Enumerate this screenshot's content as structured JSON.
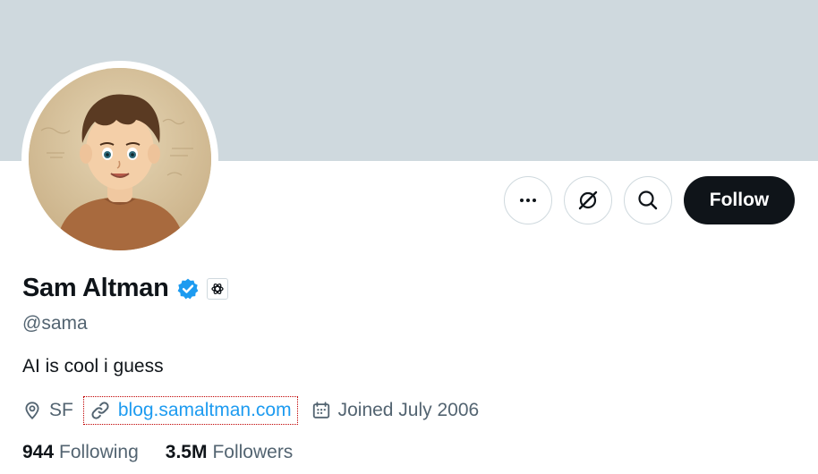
{
  "profile": {
    "name": "Sam Altman",
    "handle": "@sama",
    "bio": "AI is cool i guess",
    "location": "SF",
    "website": "blog.samaltman.com",
    "joined": "Joined July 2006"
  },
  "actions": {
    "follow_label": "Follow",
    "more_icon": "more-horizontal-icon",
    "grok_icon": "grok-icon",
    "search_icon": "search-icon"
  },
  "stats": {
    "following_count": "944",
    "following_label": "Following",
    "followers_count": "3.5M",
    "followers_label": "Followers"
  },
  "colors": {
    "banner": "#cfd9de",
    "verified": "#1d9bf0",
    "link": "#1d9bf0",
    "follow_bg": "#0f1419"
  },
  "icons": {
    "verified": "verified-badge-icon",
    "affiliation": "openai-logo-icon",
    "location": "location-pin-icon",
    "link": "link-icon",
    "calendar": "calendar-icon"
  }
}
